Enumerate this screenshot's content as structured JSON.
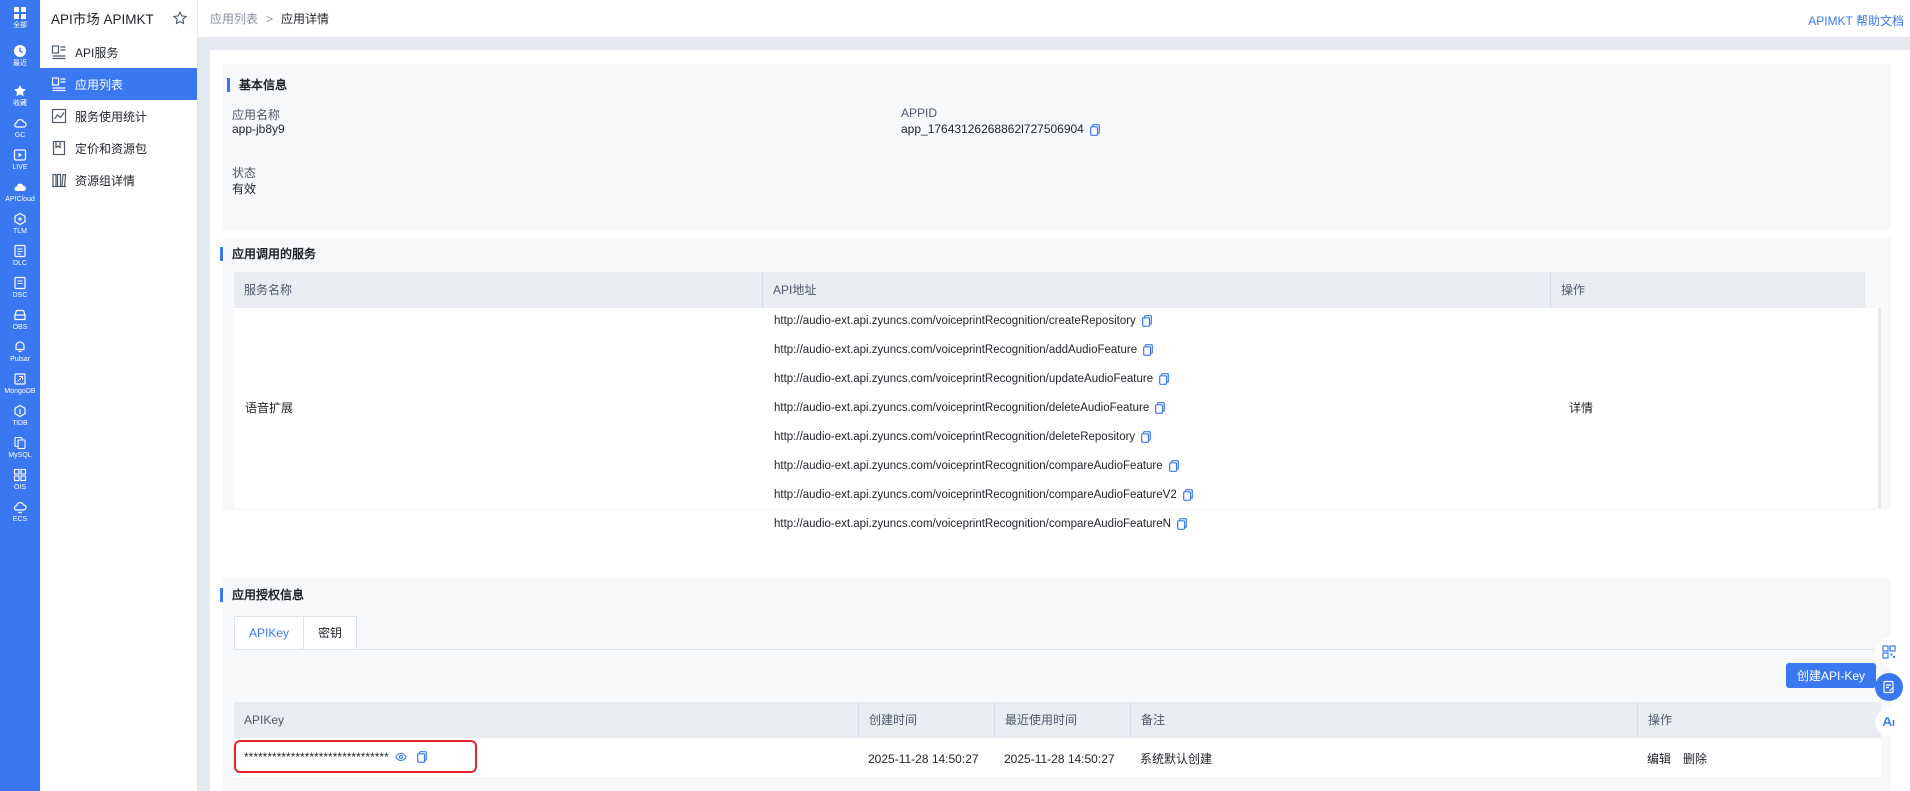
{
  "rail": {
    "items": [
      {
        "label": "全部",
        "icon": "grid-icon"
      },
      {
        "label": "最近",
        "icon": "clock-icon"
      },
      {
        "label": "收藏",
        "icon": "star-icon"
      },
      {
        "label": "GC",
        "icon": "cloud-icon"
      },
      {
        "label": "LIVE",
        "icon": "play-icon"
      },
      {
        "label": "APICloud",
        "icon": "cloud-icon"
      },
      {
        "label": "TLM",
        "icon": "hexagon-icon"
      },
      {
        "label": "DLC",
        "icon": "db-icon"
      },
      {
        "label": "DSC",
        "icon": "db-icon"
      },
      {
        "label": "OBS",
        "icon": "storage-icon"
      },
      {
        "label": "Pulsar",
        "icon": "pulsar-icon"
      },
      {
        "label": "MongoDB",
        "icon": "db-icon"
      },
      {
        "label": "TiDB",
        "icon": "hexagon-icon"
      },
      {
        "label": "MySQL",
        "icon": "db-icon"
      },
      {
        "label": "OIS",
        "icon": "grid-icon"
      },
      {
        "label": "ECS",
        "icon": "cloud-icon"
      }
    ]
  },
  "subnav": {
    "title": "API市场 APIMKT",
    "items": [
      {
        "label": "API服务",
        "icon": "api-icon",
        "active": false
      },
      {
        "label": "应用列表",
        "icon": "app-list-icon",
        "active": true
      },
      {
        "label": "服务使用统计",
        "icon": "chart-icon",
        "active": false
      },
      {
        "label": "定价和资源包",
        "icon": "package-icon",
        "active": false
      },
      {
        "label": "资源组详情",
        "icon": "resource-icon",
        "active": false
      }
    ]
  },
  "topbar": {
    "breadcrumb": [
      "应用列表",
      ">",
      "应用详情"
    ],
    "help_link": "APIMKT 帮助文档"
  },
  "basic_info": {
    "title": "基本信息",
    "app_name_label": "应用名称",
    "app_name": "app-jb8y9",
    "appid_label": "APPID",
    "appid": "app_17643126268862l727506904",
    "status_label": "状态",
    "status": "有效"
  },
  "services": {
    "title": "应用调用的服务",
    "columns": [
      "服务名称",
      "API地址",
      "操作"
    ],
    "service_name": "语音扩展",
    "action": "详情",
    "api_urls": [
      "http://audio-ext.api.zyuncs.com/voiceprintRecognition/createRepository",
      "http://audio-ext.api.zyuncs.com/voiceprintRecognition/addAudioFeature",
      "http://audio-ext.api.zyuncs.com/voiceprintRecognition/updateAudioFeature",
      "http://audio-ext.api.zyuncs.com/voiceprintRecognition/deleteAudioFeature",
      "http://audio-ext.api.zyuncs.com/voiceprintRecognition/deleteRepository",
      "http://audio-ext.api.zyuncs.com/voiceprintRecognition/compareAudioFeature",
      "http://audio-ext.api.zyuncs.com/voiceprintRecognition/compareAudioFeatureV2",
      "http://audio-ext.api.zyuncs.com/voiceprintRecognition/compareAudioFeatureN"
    ]
  },
  "auth": {
    "title": "应用授权信息",
    "tabs": [
      {
        "label": "APIKey",
        "active": true
      },
      {
        "label": "密钥",
        "active": false
      }
    ],
    "create_button": "创建API-Key",
    "columns": [
      "APIKey",
      "创建时间",
      "最近使用时间",
      "备注",
      "操作"
    ],
    "row": {
      "masked_key": "*******************************",
      "created": "2025-11-28 14:50:27",
      "last_used": "2025-11-28 14:50:27",
      "remark": "系统默认创建",
      "edit": "编辑",
      "delete": "删除"
    }
  },
  "colors": {
    "accent": "#3a78f2",
    "highlight_border": "#e8212e"
  }
}
